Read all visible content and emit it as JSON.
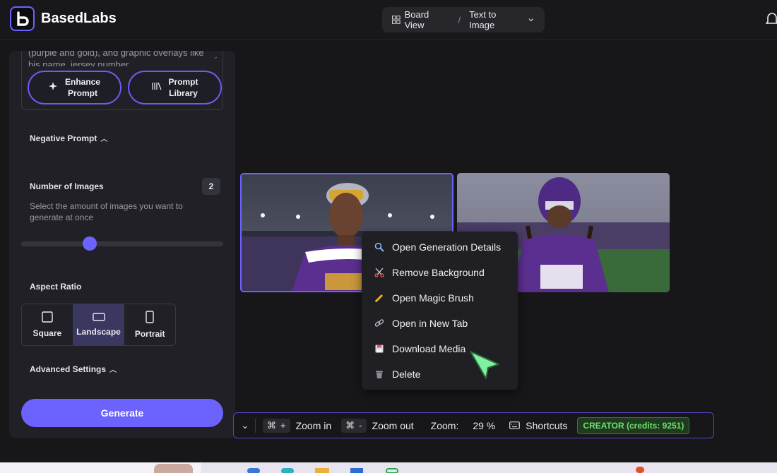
{
  "app": {
    "name": "BasedLabs"
  },
  "header": {
    "board_view": "Board View",
    "separator": "/",
    "mode": "Text to Image"
  },
  "sidebar": {
    "prompt_text": "(purple and gold), and graphic overlays like his name, jersey number",
    "enhance_label_1": "Enhance",
    "enhance_label_2": "Prompt",
    "library_label_1": "Prompt",
    "library_label_2": "Library",
    "negative_prompt_label": "Negative Prompt",
    "num_images_label": "Number of Images",
    "num_images_value": "2",
    "num_images_desc": "Select the amount of images you want to generate at once",
    "slider_fraction": 0.34,
    "aspect_label": "Aspect Ratio",
    "aspect_options": [
      "Square",
      "Landscape",
      "Portrait"
    ],
    "aspect_selected": "Landscape",
    "advanced_label": "Advanced Settings",
    "generate_label": "Generate"
  },
  "context_menu": {
    "items": [
      {
        "label": "Open Generation Details",
        "icon": "magnifier-icon"
      },
      {
        "label": "Remove Background",
        "icon": "scissors-icon"
      },
      {
        "label": "Open Magic Brush",
        "icon": "pencil-icon"
      },
      {
        "label": "Open in New Tab",
        "icon": "link-icon"
      },
      {
        "label": "Download Media",
        "icon": "floppy-icon"
      },
      {
        "label": "Delete",
        "icon": "trash-icon"
      }
    ]
  },
  "toolbar": {
    "cmd": "⌘",
    "plus": "+",
    "minus": "-",
    "zoom_in": "Zoom in",
    "zoom_out": "Zoom out",
    "zoom_label": "Zoom:",
    "zoom_value": "29 %",
    "shortcuts": "Shortcuts",
    "credits": "CREATOR (credits: 9251)"
  },
  "colors": {
    "accent": "#6c63ff",
    "credits_green": "#6ee06e",
    "cursor_green": "#7ff0a0"
  }
}
